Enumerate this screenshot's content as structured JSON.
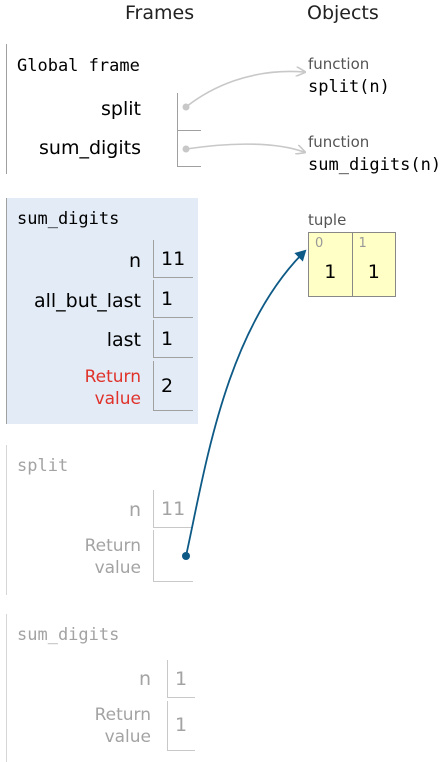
{
  "headers": {
    "frames": "Frames",
    "objects": "Objects"
  },
  "global_frame": {
    "title": "Global frame",
    "vars": [
      {
        "name": "split"
      },
      {
        "name": "sum_digits"
      }
    ]
  },
  "active_frame": {
    "title": "sum_digits",
    "vars": [
      {
        "name": "n",
        "value": "11"
      },
      {
        "name": "all_but_last",
        "value": "1"
      },
      {
        "name": "last",
        "value": "1"
      }
    ],
    "return_label": "Return\nvalue",
    "return_value": "2"
  },
  "split_frame": {
    "title": "split",
    "vars": [
      {
        "name": "n",
        "value": "11"
      }
    ],
    "return_label": "Return\nvalue"
  },
  "sum_digits_frame_2": {
    "title": "sum_digits",
    "vars": [
      {
        "name": "n",
        "value": "1"
      }
    ],
    "return_label": "Return\nvalue",
    "return_value": "1"
  },
  "objects": {
    "split_fn": {
      "type_label": "function",
      "name": "split(n)"
    },
    "sum_digits_fn": {
      "type_label": "function",
      "name": "sum_digits(n)"
    },
    "tuple": {
      "type_label": "tuple",
      "items": [
        {
          "index": "0",
          "value": "1"
        },
        {
          "index": "1",
          "value": "1"
        }
      ]
    }
  },
  "colors": {
    "active_frame_bg": "#e2ebf6",
    "return_label": "#e0322a",
    "active_arrow": "#0e5a86",
    "inactive_arrow": "#c8c8c8",
    "tuple_bg": "#ffffc6"
  }
}
